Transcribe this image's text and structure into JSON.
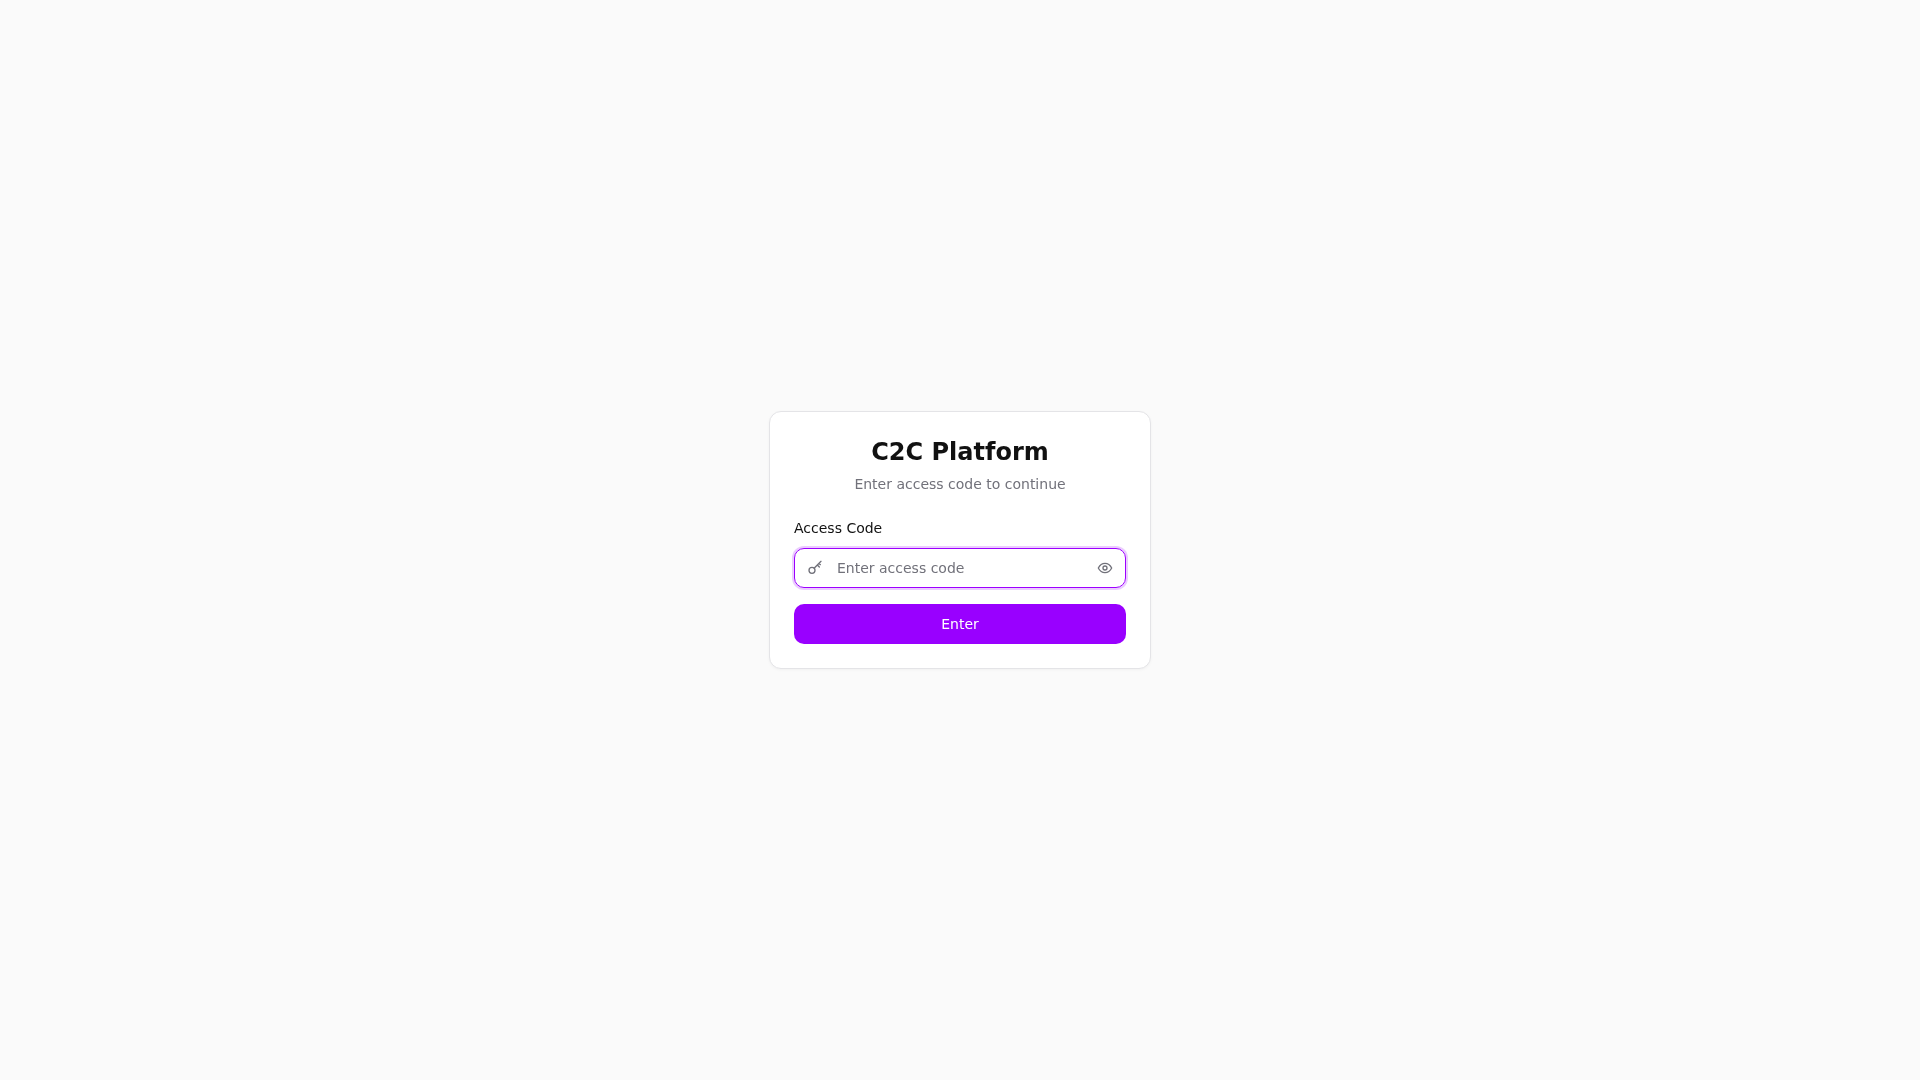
{
  "card": {
    "title": "C2C Platform",
    "subtitle": "Enter access code to continue"
  },
  "field": {
    "label": "Access Code",
    "placeholder": "Enter access code",
    "focused": true
  },
  "button": {
    "label": "Enter"
  }
}
